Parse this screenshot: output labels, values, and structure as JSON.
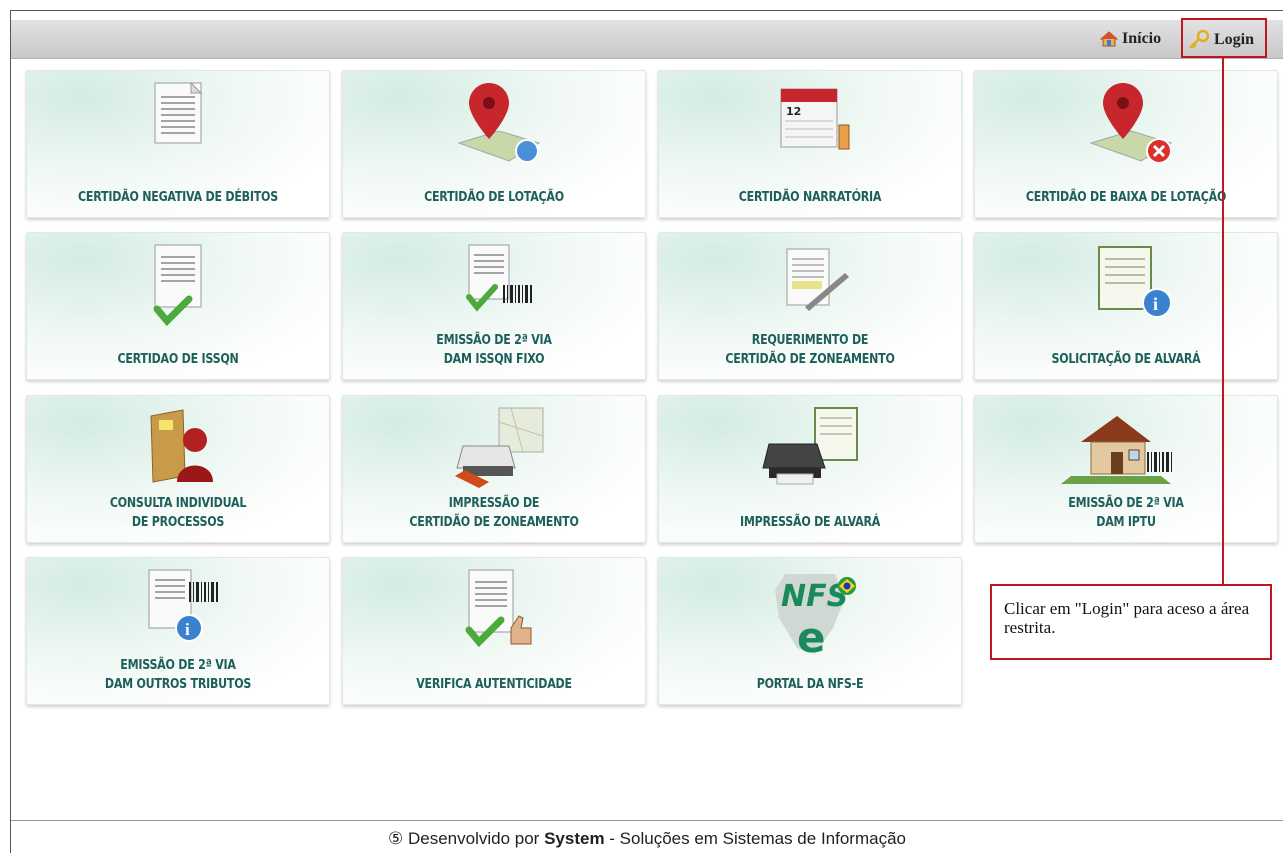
{
  "nav": {
    "home_label": "Início",
    "login_label": "Login"
  },
  "tiles": [
    {
      "label": "CERTIDÃO NEGATIVA DE DÉBITOS",
      "icon": "document-icon"
    },
    {
      "label": "CERTIDÃO DE LOTAÇÃO",
      "icon": "map-pin-icon"
    },
    {
      "label": "CERTIDÃO NARRATÓRIA",
      "icon": "calendar-icon"
    },
    {
      "label": "CERTIDÃO DE BAIXA DE LOTAÇÃO",
      "icon": "map-pin-remove-icon"
    },
    {
      "label": "CERTIDAO DE ISSQN",
      "icon": "document-check-icon"
    },
    {
      "label": "EMISSÃO DE 2ª VIA\nDAM ISSQN FIXO",
      "icon": "document-barcode-icon"
    },
    {
      "label": "REQUERIMENTO DE\nCERTIDÃO DE ZONEAMENTO",
      "icon": "document-pen-icon"
    },
    {
      "label": "SOLICITAÇÃO DE ALVARÁ",
      "icon": "certificate-info-icon"
    },
    {
      "label": "CONSULTA INDIVIDUAL\nDE PROCESSOS",
      "icon": "folder-user-icon"
    },
    {
      "label": "IMPRESSÃO DE\nCERTIDÃO DE ZONEAMENTO",
      "icon": "printer-map-icon"
    },
    {
      "label": "IMPRESSÃO DE ALVARÁ",
      "icon": "printer-certificate-icon"
    },
    {
      "label": "EMISSÃO DE 2ª VIA\nDAM IPTU",
      "icon": "house-barcode-icon"
    },
    {
      "label": "EMISSÃO DE 2ª VIA\nDAM OUTROS TRIBUTOS",
      "icon": "document-barcode-info-icon"
    },
    {
      "label": "VERIFICA AUTENTICIDADE",
      "icon": "document-thumbsup-icon"
    },
    {
      "label": "PORTAL DA NFS-e",
      "icon": "nfse-logo-icon"
    }
  ],
  "callout": {
    "text": "Clicar em \"Login\" para aceso a área restrita."
  },
  "footer": {
    "prefix": "Desenvolvido por",
    "company": "System",
    "suffix": "- Soluções em Sistemas de Informação"
  },
  "colors": {
    "accent_red": "#c0171e",
    "tile_text": "#1d5f5a"
  }
}
